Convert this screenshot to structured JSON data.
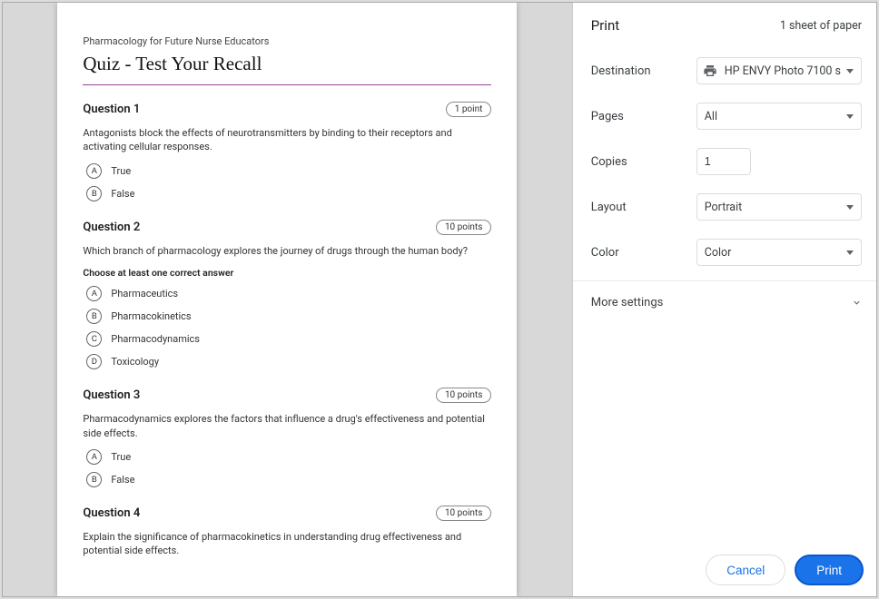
{
  "preview": {
    "course_title": "Pharmacology for Future Nurse Educators",
    "quiz_title": "Quiz - Test Your Recall",
    "questions": [
      {
        "number": "Question 1",
        "points": "1 point",
        "text": "Antagonists block the effects of neurotransmitters by binding to their receptors and activating cellular responses.",
        "instruction": "",
        "options": [
          {
            "letter": "A",
            "text": "True"
          },
          {
            "letter": "B",
            "text": "False"
          }
        ]
      },
      {
        "number": "Question 2",
        "points": "10 points",
        "text": "Which branch of pharmacology explores the journey of drugs through the human body?",
        "instruction": "Choose at least one correct answer",
        "options": [
          {
            "letter": "A",
            "text": "Pharmaceutics"
          },
          {
            "letter": "B",
            "text": "Pharmacokinetics"
          },
          {
            "letter": "C",
            "text": "Pharmacodynamics"
          },
          {
            "letter": "D",
            "text": "Toxicology"
          }
        ]
      },
      {
        "number": "Question 3",
        "points": "10 points",
        "text": "Pharmacodynamics explores the factors that influence a drug's effectiveness and potential side effects.",
        "instruction": "",
        "options": [
          {
            "letter": "A",
            "text": "True"
          },
          {
            "letter": "B",
            "text": "False"
          }
        ]
      },
      {
        "number": "Question 4",
        "points": "10 points",
        "text": "Explain the significance of pharmacokinetics in understanding drug effectiveness and potential side effects.",
        "instruction": "",
        "options": []
      }
    ]
  },
  "panel": {
    "title": "Print",
    "sheet_count": "1 sheet of paper",
    "destination_label": "Destination",
    "destination_value": "HP ENVY Photo 7100 s",
    "pages_label": "Pages",
    "pages_value": "All",
    "copies_label": "Copies",
    "copies_value": "1",
    "layout_label": "Layout",
    "layout_value": "Portrait",
    "color_label": "Color",
    "color_value": "Color",
    "more_settings": "More settings",
    "cancel": "Cancel",
    "print": "Print"
  }
}
